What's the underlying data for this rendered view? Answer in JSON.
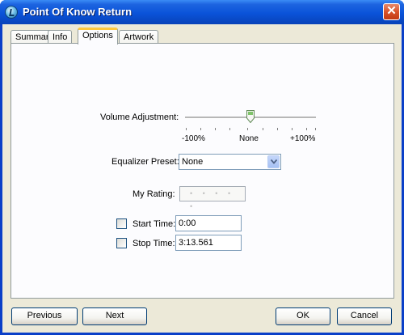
{
  "window": {
    "title": "Point Of Know Return"
  },
  "tabs": [
    {
      "label": "Summary"
    },
    {
      "label": "Info"
    },
    {
      "label": "Options",
      "active": true
    },
    {
      "label": "Artwork"
    }
  ],
  "options": {
    "volume": {
      "label": "Volume Adjustment:",
      "min_label": "-100%",
      "mid_label": "None",
      "max_label": "+100%",
      "value_percent": 0
    },
    "equalizer": {
      "label": "Equalizer Preset:",
      "value": "None"
    },
    "rating": {
      "label": "My Rating:",
      "value": "• • • • •"
    },
    "start_time": {
      "label": "Start Time:",
      "value": "0:00",
      "checked": false
    },
    "stop_time": {
      "label": "Stop Time:",
      "value": "3:13.561",
      "checked": false
    }
  },
  "buttons": {
    "previous": "Previous",
    "next": "Next",
    "ok": "OK",
    "cancel": "Cancel"
  },
  "icons": {
    "app": "itunes-icon",
    "close": "close-icon",
    "dropdown": "chevron-down-icon"
  }
}
